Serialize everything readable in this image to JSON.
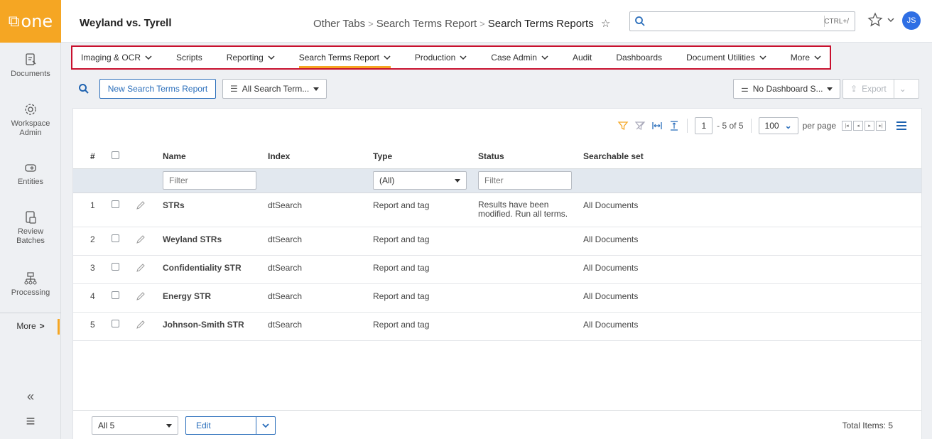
{
  "app": {
    "logo_text": "one"
  },
  "rail": {
    "items": [
      {
        "label": "Documents",
        "icon": "documents-icon"
      },
      {
        "label": "Workspace Admin",
        "icon": "gear-icon"
      },
      {
        "label": "Entities",
        "icon": "entities-icon"
      },
      {
        "label": "Review Batches",
        "icon": "review-batches-icon"
      },
      {
        "label": "Processing",
        "icon": "processing-icon"
      }
    ],
    "more_label": "More",
    "collapse_glyph": "«",
    "menu_glyph": "≡"
  },
  "header": {
    "workspace": "Weyland vs. Tyrell",
    "breadcrumbs": [
      "Other Tabs",
      "Search Terms Report",
      "Search Terms Reports"
    ],
    "search_placeholder": "",
    "search_shortcut": "CTRL+/",
    "avatar_initials": "JS"
  },
  "tabs": [
    {
      "label": "Imaging & OCR",
      "chevron": true
    },
    {
      "label": "Scripts",
      "chevron": false
    },
    {
      "label": "Reporting",
      "chevron": true
    },
    {
      "label": "Search Terms Report",
      "chevron": true,
      "active": true
    },
    {
      "label": "Production",
      "chevron": true
    },
    {
      "label": "Case Admin",
      "chevron": true
    },
    {
      "label": "Audit",
      "chevron": false
    },
    {
      "label": "Dashboards",
      "chevron": false
    },
    {
      "label": "Document Utilities",
      "chevron": true
    },
    {
      "label": "More",
      "chevron": true
    }
  ],
  "toolbar": {
    "new_button": "New Search Terms Report",
    "view_select": "All Search Term...",
    "dashboard_select": "No Dashboard S...",
    "export_button": "Export"
  },
  "pager": {
    "page": "1",
    "range": "- 5 of 5",
    "per_page_value": "100",
    "per_page_label": "per page"
  },
  "grid": {
    "columns": [
      "#",
      "Name",
      "Index",
      "Type",
      "Status",
      "Searchable set"
    ],
    "filter_placeholder": "Filter",
    "type_filter_value": "(All)",
    "rows": [
      {
        "num": "1",
        "name": "STRs",
        "index": "dtSearch",
        "type": "Report and tag",
        "status_line1": "Results have been",
        "status_line2": "modified. Run all terms.",
        "set": "All Documents"
      },
      {
        "num": "2",
        "name": "Weyland STRs",
        "index": "dtSearch",
        "type": "Report and tag",
        "status_line1": "",
        "status_line2": "",
        "set": "All Documents"
      },
      {
        "num": "3",
        "name": "Confidentiality STR",
        "index": "dtSearch",
        "type": "Report and tag",
        "status_line1": "",
        "status_line2": "",
        "set": "All Documents"
      },
      {
        "num": "4",
        "name": "Energy STR",
        "index": "dtSearch",
        "type": "Report and tag",
        "status_line1": "",
        "status_line2": "",
        "set": "All Documents"
      },
      {
        "num": "5",
        "name": "Johnson-Smith STR",
        "index": "dtSearch",
        "type": "Report and tag",
        "status_line1": "",
        "status_line2": "",
        "set": "All Documents"
      }
    ]
  },
  "bottom": {
    "select_value": "All 5",
    "edit_label": "Edit",
    "total": "Total Items: 5"
  },
  "colors": {
    "accent": "#f5a623",
    "link": "#1f63b0",
    "tab_highlight": "#c8102e",
    "avatar": "#2f6fe4"
  }
}
